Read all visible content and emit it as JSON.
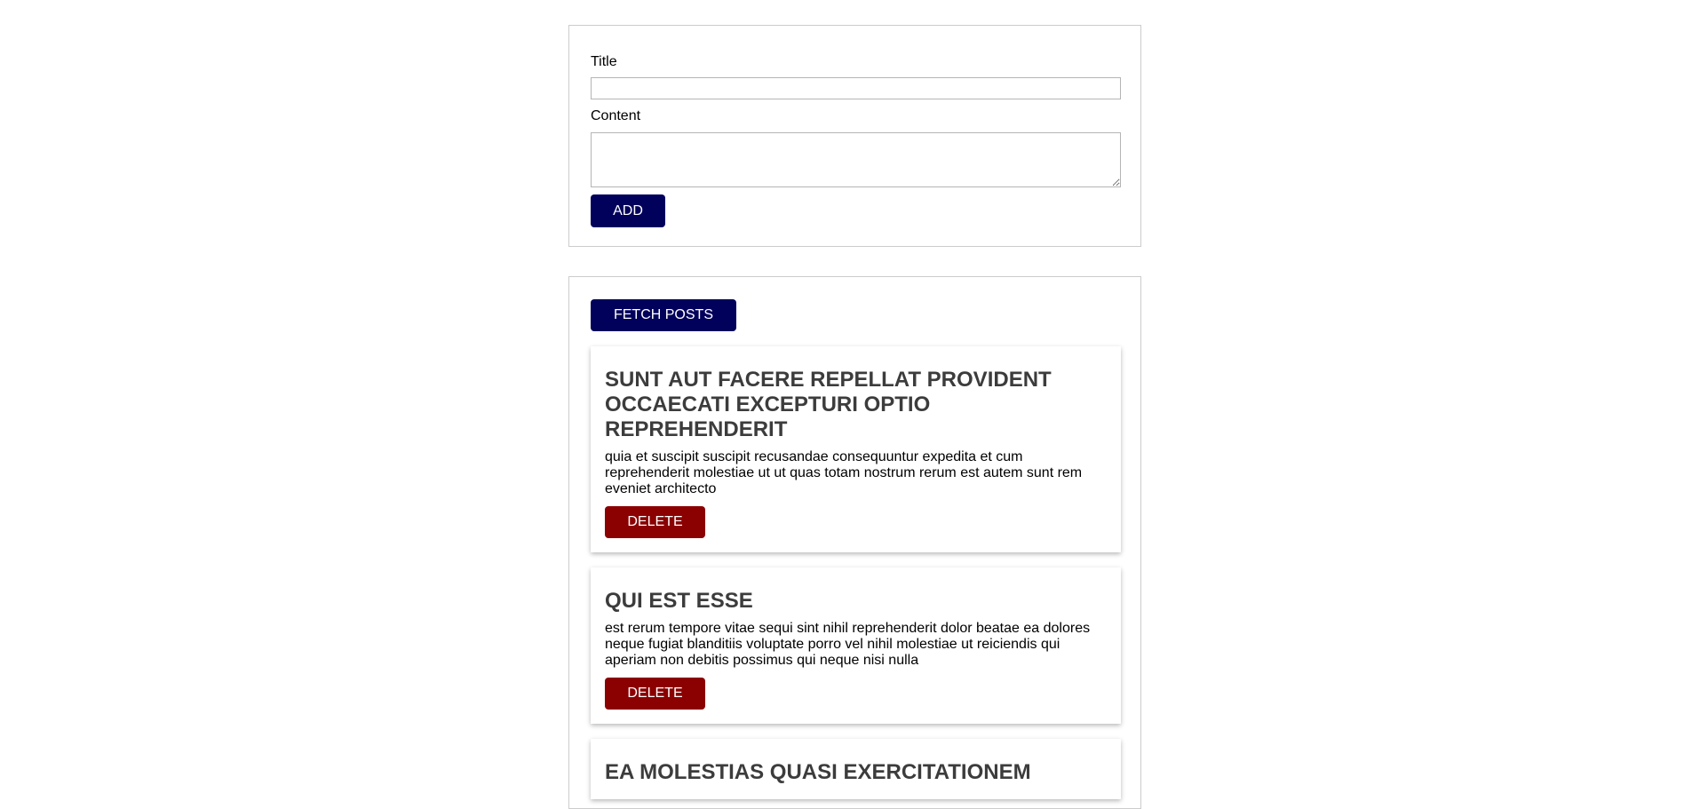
{
  "form": {
    "title_label": "Title",
    "title_value": "",
    "content_label": "Content",
    "content_value": "",
    "add_label": "ADD"
  },
  "posts_panel": {
    "fetch_label": "FETCH POSTS",
    "posts": [
      {
        "title": "SUNT AUT FACERE REPELLAT PROVIDENT OCCAECATI EXCEPTURI OPTIO REPREHENDERIT",
        "body": "quia et suscipit suscipit recusandae consequuntur expedita et cum reprehenderit molestiae ut ut quas totam nostrum rerum est autem sunt rem eveniet architecto",
        "delete_label": "DELETE"
      },
      {
        "title": "QUI EST ESSE",
        "body": "est rerum tempore vitae sequi sint nihil reprehenderit dolor beatae ea dolores neque fugiat blanditiis voluptate porro vel nihil molestiae ut reiciendis qui aperiam non debitis possimus qui neque nisi nulla",
        "delete_label": "DELETE"
      },
      {
        "title": "EA MOLESTIAS QUASI EXERCITATIONEM",
        "body": "",
        "delete_label": ""
      }
    ]
  },
  "colors": {
    "primary_button": "#01005b",
    "danger_button": "#8b0000",
    "post_title": "#3c3c3c"
  }
}
